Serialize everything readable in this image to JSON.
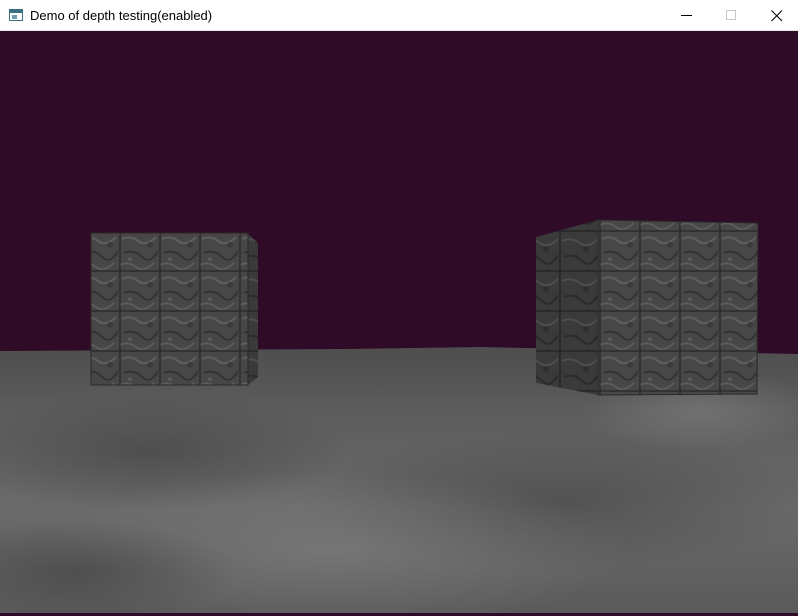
{
  "window": {
    "title": "Demo of depth testing(enabled)",
    "controls": {
      "minimize_icon": "minimize-icon",
      "maximize_icon": "maximize-icon",
      "close_icon": "close-icon"
    }
  },
  "scene": {
    "background_color": "#2f0b27",
    "floor_color": "#5b5b5b",
    "cube_color": "#4a4a4a"
  }
}
